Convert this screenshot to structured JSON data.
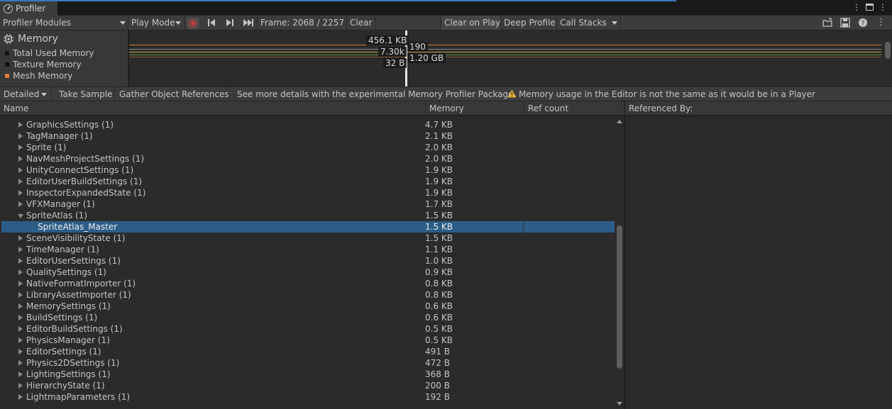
{
  "window": {
    "tab_title": "Profiler"
  },
  "toolbar": {
    "modules_dropdown": "Profiler Modules",
    "play_mode": "Play Mode",
    "frame_label": "Frame: 2068 / 2257",
    "clear": "Clear",
    "clear_on_play": "Clear on Play",
    "deep_profile": "Deep Profile",
    "call_stacks": "Call Stacks"
  },
  "module": {
    "title": "Memory",
    "legend": [
      {
        "label": "Total Used Memory",
        "color": "#1a1a1a"
      },
      {
        "label": "Texture Memory",
        "color": "#1a1a1a"
      },
      {
        "label": "Mesh Memory",
        "color": "#e07b39"
      }
    ]
  },
  "graph": {
    "labels_left": [
      "456.1 KB",
      "7.30k",
      "32 B"
    ],
    "labels_right": [
      "190",
      "1.20 GB"
    ],
    "colors": {
      "orange": "#c8792c",
      "yellow": "#b8a83a",
      "green": "#6a8a3c",
      "grey": "#8a8a8a"
    }
  },
  "detail": {
    "view_mode": "Detailed",
    "take_sample": "Take Sample",
    "gather_refs": "Gather Object References",
    "more_details": "See more details with the experimental Memory Profiler Package.",
    "warning": "Memory usage in the Editor is not the same as it would be in a Player"
  },
  "columns": {
    "name": "Name",
    "memory": "Memory",
    "ref_count": "Ref count",
    "referenced_by": "Referenced By:"
  },
  "rows": [
    {
      "name": "GraphicsSettings (1)",
      "memory": "4.7 KB"
    },
    {
      "name": "TagManager (1)",
      "memory": "2.1 KB"
    },
    {
      "name": "Sprite (1)",
      "memory": "2.0 KB"
    },
    {
      "name": "NavMeshProjectSettings (1)",
      "memory": "2.0 KB"
    },
    {
      "name": "UnityConnectSettings (1)",
      "memory": "1.9 KB"
    },
    {
      "name": "EditorUserBuildSettings (1)",
      "memory": "1.9 KB"
    },
    {
      "name": "InspectorExpandedState (1)",
      "memory": "1.9 KB"
    },
    {
      "name": "VFXManager (1)",
      "memory": "1.7 KB"
    },
    {
      "name": "SpriteAtlas (1)",
      "memory": "1.5 KB"
    },
    {
      "name": "SpriteAtlas_Master",
      "memory": "1.5 KB"
    },
    {
      "name": "SceneVisibilityState (1)",
      "memory": "1.5 KB"
    },
    {
      "name": "TimeManager (1)",
      "memory": "1.1 KB"
    },
    {
      "name": "EditorUserSettings (1)",
      "memory": "1.0 KB"
    },
    {
      "name": "QualitySettings (1)",
      "memory": "0.9 KB"
    },
    {
      "name": "NativeFormatImporter (1)",
      "memory": "0.8 KB"
    },
    {
      "name": "LibraryAssetImporter (1)",
      "memory": "0.8 KB"
    },
    {
      "name": "MemorySettings (1)",
      "memory": "0.6 KB"
    },
    {
      "name": "BuildSettings (1)",
      "memory": "0.6 KB"
    },
    {
      "name": "EditorBuildSettings (1)",
      "memory": "0.5 KB"
    },
    {
      "name": "PhysicsManager (1)",
      "memory": "0.5 KB"
    },
    {
      "name": "EditorSettings (1)",
      "memory": "491 B"
    },
    {
      "name": "Physics2DSettings (1)",
      "memory": "472 B"
    },
    {
      "name": "LightingSettings (1)",
      "memory": "368 B"
    },
    {
      "name": "HierarchyState (1)",
      "memory": "200 B"
    },
    {
      "name": "LightmapParameters (1)",
      "memory": "192 B"
    }
  ]
}
